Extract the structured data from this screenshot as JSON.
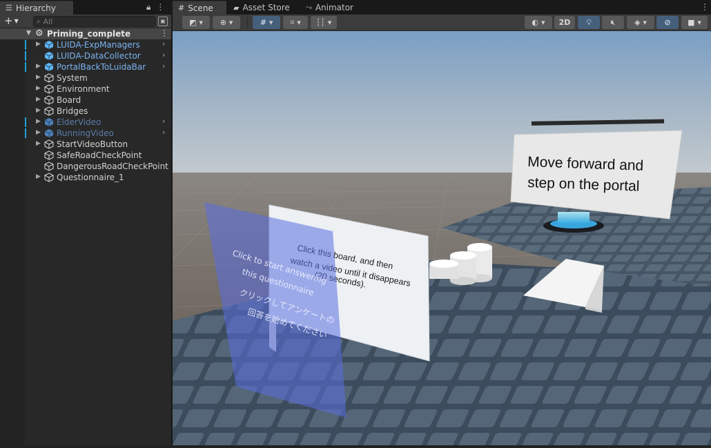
{
  "hierarchy": {
    "tab_label": "Hierarchy",
    "add_symbol": "+",
    "search_placeholder": "All",
    "scene": {
      "name": "Priming_complete"
    },
    "items": [
      {
        "label": "LUIDA-ExpManagers",
        "style": "prefab",
        "expandable": true,
        "prefab_arrow": true
      },
      {
        "label": "LUIDA-DataCollector",
        "style": "prefab",
        "expandable": false,
        "prefab_arrow": true
      },
      {
        "label": "PortalBackToLuidaBar",
        "style": "prefab",
        "expandable": true,
        "prefab_arrow": true
      },
      {
        "label": "System",
        "style": "normal",
        "expandable": true
      },
      {
        "label": "Environment",
        "style": "normal",
        "expandable": true
      },
      {
        "label": "Board",
        "style": "normal",
        "expandable": true
      },
      {
        "label": "Bridges",
        "style": "normal",
        "expandable": true
      },
      {
        "label": "ElderVideo",
        "style": "prefab-dim",
        "expandable": true,
        "prefab_arrow": true
      },
      {
        "label": "RunningVideo",
        "style": "prefab-dim",
        "expandable": true,
        "prefab_arrow": true
      },
      {
        "label": "StartVideoButton",
        "style": "normal",
        "expandable": true
      },
      {
        "label": "SafeRoadCheckPoint",
        "style": "normal",
        "expandable": false
      },
      {
        "label": "DangerousRoadCheckPoint",
        "style": "normal",
        "expandable": false
      },
      {
        "label": "Questionnaire_1",
        "style": "normal",
        "expandable": true
      }
    ]
  },
  "scene_view": {
    "tabs": [
      {
        "label": "Scene",
        "icon": "hash-grid-icon",
        "active": true
      },
      {
        "label": "Asset Store",
        "icon": "shopping-bag-icon",
        "active": false
      },
      {
        "label": "Animator",
        "icon": "animator-icon",
        "active": false
      }
    ],
    "toolbar": {
      "mode_2d_label": "2D"
    },
    "signs": {
      "portal_sign_line1": "Move forward and",
      "portal_sign_line2": "step on the portal",
      "board_line1": "Click this board, and then",
      "board_line2": "watch a video until it disappears",
      "board_line3": "(20 seconds).",
      "question_line1": "Click to start answering",
      "question_line2": "this questionnaire",
      "question_line3": "クリックしてアンケートの",
      "question_line4": "回答を始めてください"
    }
  },
  "colors": {
    "prefab_text": "#7bb3f0",
    "prefab_dim_text": "#5a7ca6",
    "selection_marker": "#21a5d5",
    "panel_bg": "#282828",
    "toolbar_bg": "#3c3c3c",
    "active_toggle": "#46607c"
  }
}
